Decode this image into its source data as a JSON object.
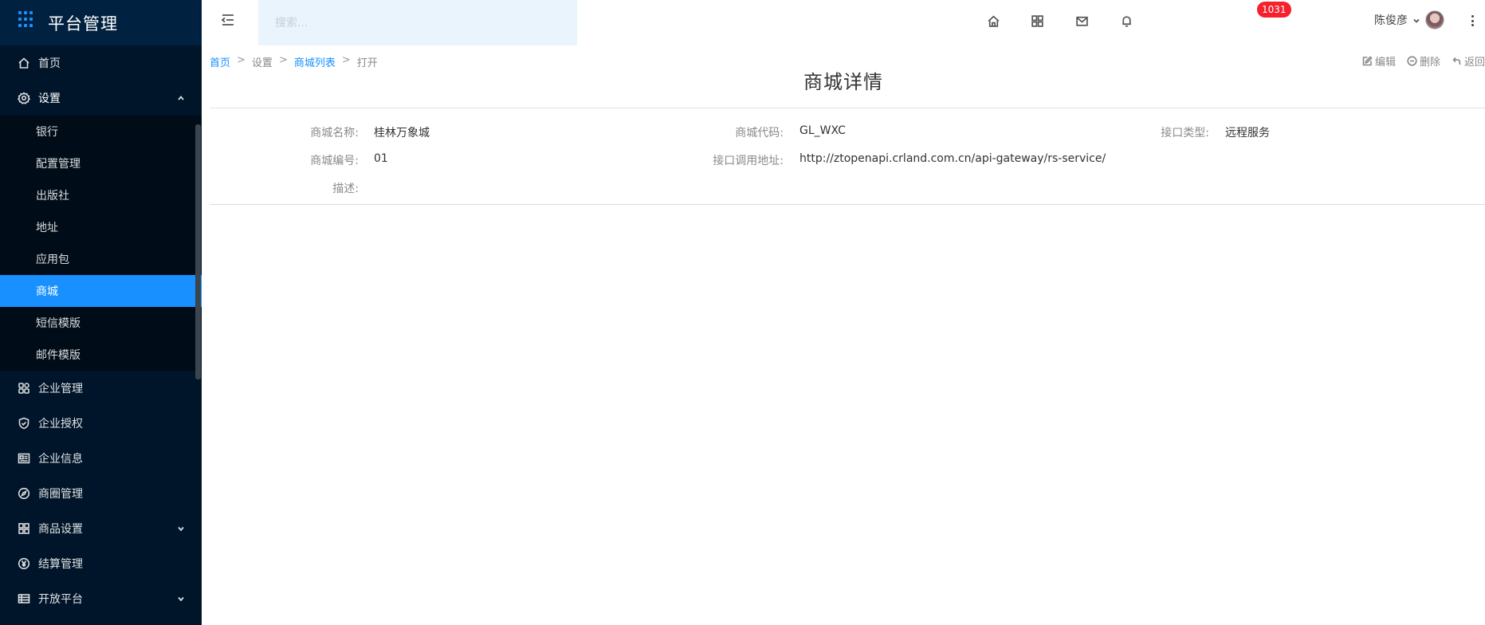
{
  "sidebar": {
    "app_title": "平台管理",
    "menu": [
      {
        "label": "首页",
        "icon": "home-icon"
      },
      {
        "label": "设置",
        "icon": "gear-icon",
        "open": true
      }
    ],
    "submenu": [
      {
        "label": "银行"
      },
      {
        "label": "配置管理"
      },
      {
        "label": "出版社"
      },
      {
        "label": "地址"
      },
      {
        "label": "应用包"
      },
      {
        "label": "商城",
        "active": true
      },
      {
        "label": "短信模版"
      },
      {
        "label": "邮件模版"
      }
    ],
    "menu_after": [
      {
        "label": "企业管理",
        "icon": "building-icon"
      },
      {
        "label": "企业授权",
        "icon": "shield-icon"
      },
      {
        "label": "企业信息",
        "icon": "info-card-icon"
      },
      {
        "label": "商圈管理",
        "icon": "compass-icon"
      },
      {
        "label": "商品设置",
        "icon": "grid-icon",
        "expandable": true
      },
      {
        "label": "结算管理",
        "icon": "yen-icon"
      },
      {
        "label": "开放平台",
        "icon": "table-icon",
        "expandable": true
      }
    ]
  },
  "header": {
    "search_placeholder": "搜索...",
    "badge_count": "1031",
    "user_name": "陈俊彦"
  },
  "breadcrumb": {
    "home": "首页",
    "settings": "设置",
    "mall_list": "商城列表",
    "current": "打开",
    "separator": ">"
  },
  "actions": {
    "edit": "编辑",
    "delete": "删除",
    "back": "返回"
  },
  "page_title": "商城详情",
  "details": {
    "mall_name_label": "商城名称:",
    "mall_name": "桂林万象城",
    "mall_code_label": "商城代码:",
    "mall_code": "GL_WXC",
    "api_type_label": "接口类型:",
    "api_type": "远程服务",
    "mall_number_label": "商城编号:",
    "mall_number": "01",
    "api_url_label": "接口调用地址:",
    "api_url": "http://ztopenapi.crland.com.cn/api-gateway/rs-service/",
    "description_label": "描述:",
    "description": ""
  },
  "colors": {
    "sidebar_bg": "#001529",
    "submenu_bg": "#000c17",
    "accent": "#1890ff",
    "badge": "#f5222d",
    "search_bg": "#eaf4fd"
  }
}
